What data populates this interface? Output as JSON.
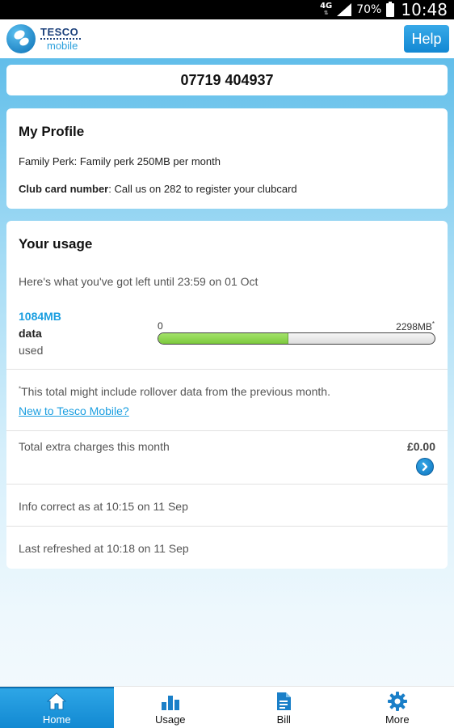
{
  "status_bar": {
    "network": "4G",
    "battery_percent": "70%",
    "time": "10:48"
  },
  "app_bar": {
    "logo_brand": "TESCO",
    "logo_sub": "mobile",
    "help_label": "Help"
  },
  "account": {
    "phone_number": "07719 404937"
  },
  "profile": {
    "title": "My Profile",
    "perk_text": "Family Perk: Family perk 250MB per month",
    "club_label": "Club card number",
    "club_text": ": Call us on 282 to register your clubcard"
  },
  "usage": {
    "title": "Your usage",
    "intro": "Here's what you've got left until 23:59 on 01 Oct",
    "used_amount": "1084MB",
    "used_unit": "data",
    "used_label": "used",
    "bar_min": "0",
    "bar_max": "2298MB",
    "bar_max_marker": "*",
    "used_fraction": 0.4717,
    "rollover_marker": "*",
    "rollover_note": "This total might include rollover data from the previous month.",
    "new_link": "New to Tesco Mobile?",
    "extra_charges_label": "Total extra charges this month",
    "extra_charges_value": "£0.00",
    "info_correct": "Info correct as at 10:15 on 11 Sep",
    "last_refreshed": "Last refreshed at 10:18 on 11 Sep"
  },
  "bottom_nav": {
    "items": [
      {
        "label": "Home",
        "icon": "home-icon",
        "active": true
      },
      {
        "label": "Usage",
        "icon": "bar-chart-icon",
        "active": false
      },
      {
        "label": "Bill",
        "icon": "document-icon",
        "active": false
      },
      {
        "label": "More",
        "icon": "gear-icon",
        "active": false
      }
    ]
  },
  "colors": {
    "accent": "#1a9ee0",
    "usage_bar_fill": "#7cc93d",
    "nav_active": "#1e95da"
  }
}
